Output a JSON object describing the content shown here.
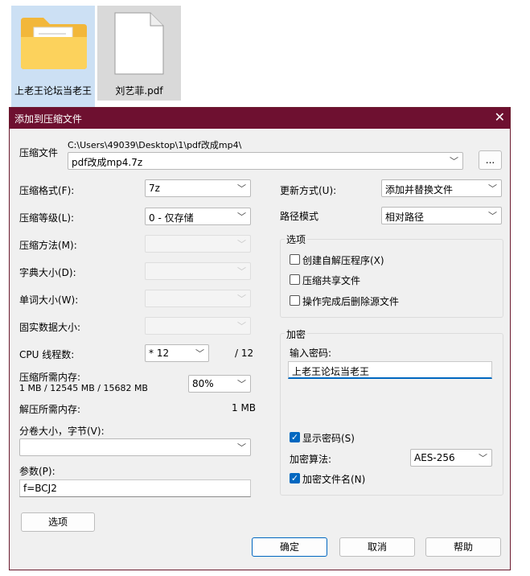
{
  "desktop": {
    "items": [
      {
        "label": "上老王论坛当老王",
        "icon": "folder-icon"
      },
      {
        "label": "刘艺菲.pdf",
        "icon": "pdf-file-icon"
      }
    ]
  },
  "dialog": {
    "title": "添加到压缩文件",
    "archive": {
      "label": "压缩文件",
      "path": "C:\\Users\\49039\\Desktop\\1\\pdf改成mp4\\",
      "filename": "pdf改成mp4.7z",
      "browse_label": "..."
    },
    "left": {
      "format_label": "压缩格式(F):",
      "format_value": "7z",
      "level_label": "压缩等级(L):",
      "level_value": "0 - 仅存储",
      "method_label": "压缩方法(M):",
      "dict_label": "字典大小(D):",
      "word_label": "单词大小(W):",
      "solid_label": "固实数据大小:",
      "cpu_label": "CPU 线程数:",
      "cpu_value": "* 12",
      "cpu_total": "/ 12",
      "mem_label": "压缩所需内存:",
      "mem_values": "1 MB / 12545 MB / 15682 MB",
      "mem_percent": "80%",
      "decomp_label": "解压所需内存:",
      "decomp_value": "1 MB",
      "split_label": "分卷大小，字节(V):",
      "split_value": "",
      "params_label": "参数(P):",
      "params_value": "f=BCJ2",
      "options_button": "选项"
    },
    "right": {
      "update_label": "更新方式(U):",
      "update_value": "添加并替换文件",
      "path_label": "路径模式",
      "path_value": "相对路径",
      "options_group": "选项",
      "opt_sfx": "创建自解压程序(X)",
      "opt_shared": "压缩共享文件",
      "opt_delete": "操作完成后删除源文件",
      "encrypt_group": "加密",
      "password_label": "输入密码:",
      "password_value": "上老王论坛当老王",
      "show_password": "显示密码(S)",
      "enc_method_label": "加密算法:",
      "enc_method_value": "AES-256",
      "encrypt_names": "加密文件名(N)"
    },
    "buttons": {
      "ok": "确定",
      "cancel": "取消",
      "help": "帮助"
    }
  }
}
